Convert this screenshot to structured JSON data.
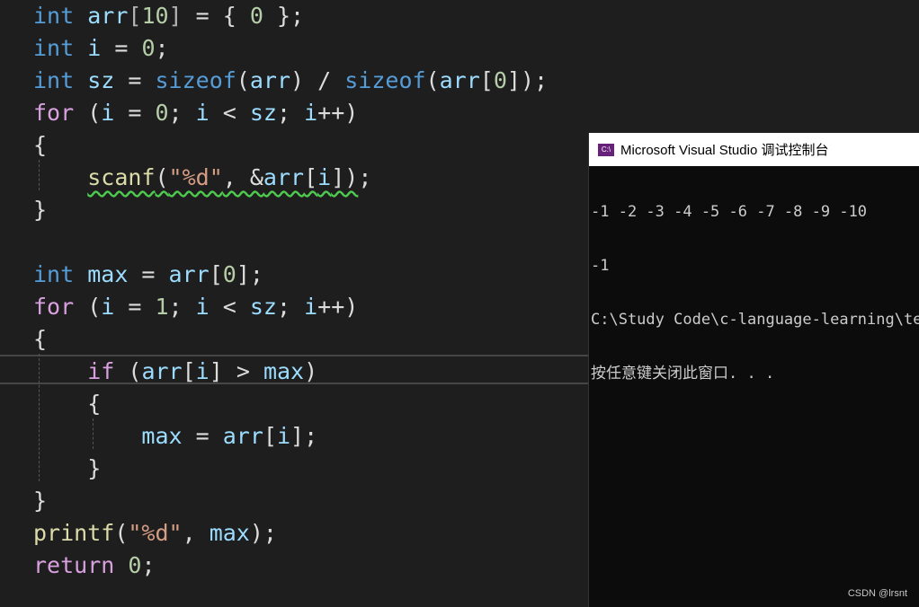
{
  "editor": {
    "lines": [
      {
        "tokens": [
          {
            "t": "int",
            "c": "kw"
          },
          {
            "t": " "
          },
          {
            "t": "arr",
            "c": "var"
          },
          {
            "t": "[",
            "c": "op"
          },
          {
            "t": "10",
            "c": "num"
          },
          {
            "t": "]",
            "c": "op"
          },
          {
            "t": " = { "
          },
          {
            "t": "0",
            "c": "num"
          },
          {
            "t": " };"
          }
        ]
      },
      {
        "tokens": [
          {
            "t": "int",
            "c": "kw"
          },
          {
            "t": " "
          },
          {
            "t": "i",
            "c": "var"
          },
          {
            "t": " = "
          },
          {
            "t": "0",
            "c": "num"
          },
          {
            "t": ";"
          }
        ]
      },
      {
        "tokens": [
          {
            "t": "int",
            "c": "kw"
          },
          {
            "t": " "
          },
          {
            "t": "sz",
            "c": "var"
          },
          {
            "t": " = "
          },
          {
            "t": "sizeof",
            "c": "kw"
          },
          {
            "t": "("
          },
          {
            "t": "arr",
            "c": "var"
          },
          {
            "t": ") / "
          },
          {
            "t": "sizeof",
            "c": "kw"
          },
          {
            "t": "("
          },
          {
            "t": "arr",
            "c": "var"
          },
          {
            "t": "["
          },
          {
            "t": "0",
            "c": "num"
          },
          {
            "t": "]);"
          }
        ]
      },
      {
        "tokens": [
          {
            "t": "for",
            "c": "kw2"
          },
          {
            "t": " ("
          },
          {
            "t": "i",
            "c": "var"
          },
          {
            "t": " = "
          },
          {
            "t": "0",
            "c": "num"
          },
          {
            "t": "; "
          },
          {
            "t": "i",
            "c": "var"
          },
          {
            "t": " < "
          },
          {
            "t": "sz",
            "c": "var"
          },
          {
            "t": "; "
          },
          {
            "t": "i",
            "c": "var"
          },
          {
            "t": "++)"
          }
        ]
      },
      {
        "tokens": [
          {
            "t": "{"
          }
        ]
      },
      {
        "tokens": [
          {
            "t": "    "
          },
          {
            "t": "scanf",
            "c": "fn",
            "sq": true
          },
          {
            "t": "(",
            "sq": true
          },
          {
            "t": "\"%d\"",
            "c": "str",
            "sq": true
          },
          {
            "t": ", &",
            "sq": true
          },
          {
            "t": "arr",
            "c": "var",
            "sq": true
          },
          {
            "t": "[",
            "sq": true
          },
          {
            "t": "i",
            "c": "var",
            "sq": true
          },
          {
            "t": "])",
            "sq": true
          },
          {
            "t": ";"
          }
        ]
      },
      {
        "tokens": [
          {
            "t": "}"
          }
        ]
      },
      {
        "tokens": []
      },
      {
        "tokens": [
          {
            "t": "int",
            "c": "kw"
          },
          {
            "t": " "
          },
          {
            "t": "max",
            "c": "var"
          },
          {
            "t": " = "
          },
          {
            "t": "arr",
            "c": "var"
          },
          {
            "t": "["
          },
          {
            "t": "0",
            "c": "num"
          },
          {
            "t": "];"
          }
        ]
      },
      {
        "tokens": [
          {
            "t": "for",
            "c": "kw2"
          },
          {
            "t": " ("
          },
          {
            "t": "i",
            "c": "var"
          },
          {
            "t": " = "
          },
          {
            "t": "1",
            "c": "num"
          },
          {
            "t": "; "
          },
          {
            "t": "i",
            "c": "var"
          },
          {
            "t": " < "
          },
          {
            "t": "sz",
            "c": "var"
          },
          {
            "t": "; "
          },
          {
            "t": "i",
            "c": "var"
          },
          {
            "t": "++)"
          }
        ]
      },
      {
        "tokens": [
          {
            "t": "{"
          }
        ]
      },
      {
        "tokens": [
          {
            "t": "    "
          },
          {
            "t": "if",
            "c": "kw2"
          },
          {
            "t": " ("
          },
          {
            "t": "arr",
            "c": "var"
          },
          {
            "t": "["
          },
          {
            "t": "i",
            "c": "var"
          },
          {
            "t": "] > "
          },
          {
            "t": "max",
            "c": "var"
          },
          {
            "t": ")"
          }
        ]
      },
      {
        "tokens": [
          {
            "t": "    {"
          }
        ]
      },
      {
        "tokens": [
          {
            "t": "        "
          },
          {
            "t": "max",
            "c": "var"
          },
          {
            "t": " = "
          },
          {
            "t": "arr",
            "c": "var"
          },
          {
            "t": "["
          },
          {
            "t": "i",
            "c": "var"
          },
          {
            "t": "];"
          }
        ]
      },
      {
        "tokens": [
          {
            "t": "    }"
          }
        ]
      },
      {
        "tokens": [
          {
            "t": "}"
          }
        ]
      },
      {
        "tokens": [
          {
            "t": "printf",
            "c": "fn"
          },
          {
            "t": "("
          },
          {
            "t": "\"%d\"",
            "c": "str"
          },
          {
            "t": ", "
          },
          {
            "t": "max",
            "c": "var"
          },
          {
            "t": ");"
          }
        ]
      },
      {
        "tokens": [
          {
            "t": "return",
            "c": "kw2"
          },
          {
            "t": " "
          },
          {
            "t": "0",
            "c": "num"
          },
          {
            "t": ";"
          }
        ]
      }
    ]
  },
  "console": {
    "icon_label": "C:\\",
    "title": "Microsoft Visual Studio 调试控制台",
    "output": [
      "-1 -2 -3 -4 -5 -6 -7 -8 -9 -10",
      "-1",
      "C:\\Study Code\\c-language-learning\\tes",
      "按任意键关闭此窗口. . ."
    ]
  },
  "watermark": "CSDN @lrsnt"
}
